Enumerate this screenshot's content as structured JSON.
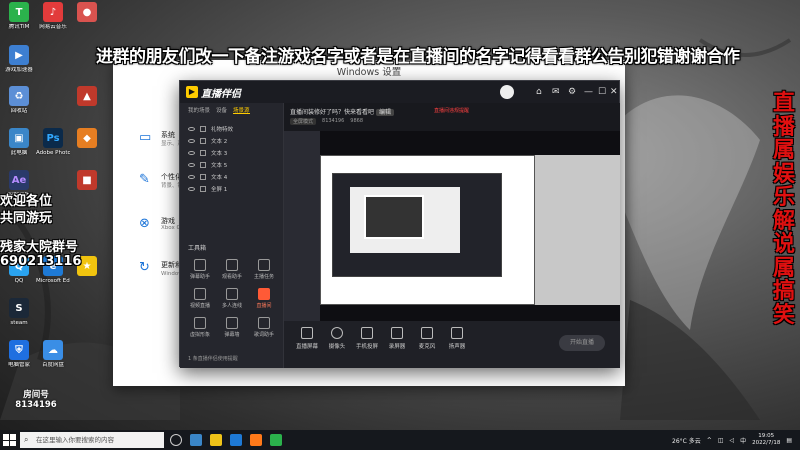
{
  "banner": {
    "top_text": "进群的朋友们改一下备注游戏名字或者是在直播间的名字记得看看群公告别犯错谢谢合作",
    "side_text": "直播属娱乐解说属搞笑",
    "welcome_line1": "欢迎各位",
    "welcome_line2": "共同游玩",
    "group_label": "残家大院群号",
    "group_number": "690213116",
    "room_label": "房间号",
    "room_number": "8134196"
  },
  "desktop": {
    "icons": [
      "腾讯TIM",
      "回收站",
      "游戏加速器",
      "此电脑",
      "Adobe Photoshop",
      "网易云音乐",
      "控制面板",
      "Microsoft Edge",
      "QQ",
      "steam",
      "百度网盘",
      "电脑管家"
    ]
  },
  "settings": {
    "title": "Windows 设置",
    "items": [
      {
        "title": "系统",
        "desc": "显示、声音"
      },
      {
        "title": "个性化",
        "desc": "背景、锁屏"
      },
      {
        "title": "游戏",
        "desc": "Xbox Game Bar"
      },
      {
        "title": "更新和安全",
        "desc": "Windows 更新"
      }
    ]
  },
  "app": {
    "name": "直播伴侣",
    "tabs": [
      "我的场景",
      "设备",
      "场景源"
    ],
    "scenes": [
      "礼物特效",
      "文本 2",
      "文本 3",
      "文本 5",
      "文本 4",
      "全屏 1"
    ],
    "toolbox_title": "工具箱",
    "tools": [
      {
        "label": "弹幕助手",
        "accent": false
      },
      {
        "label": "观看助手",
        "accent": false
      },
      {
        "label": "主播任务",
        "accent": false
      },
      {
        "label": "视频直播",
        "accent": false
      },
      {
        "label": "多人连线",
        "accent": false
      },
      {
        "label": "直播间",
        "accent": true
      },
      {
        "label": "虚拟形象",
        "accent": false
      },
      {
        "label": "弹幕墙",
        "accent": false
      },
      {
        "label": "歌词助手",
        "accent": false
      }
    ],
    "footer_text": "1 条直播伴侣使用提醒",
    "live_title": "直播间装修好了吗？快来看看吧",
    "edit_label": "编辑",
    "red_note": "直播间违规提醒",
    "meta": {
      "mode": "全屏模式",
      "fans": "8134196",
      "viewers": "9868"
    },
    "bottom_items": [
      "直播屏幕",
      "摄像头",
      "手机投屏",
      "录屏器",
      "麦克风",
      "扬声器"
    ],
    "start_label": "开始直播"
  },
  "taskbar": {
    "search_placeholder": "在这里输入你要搜索的内容",
    "weather": "26°C 多云",
    "ime": "中",
    "time": "19:05",
    "date": "2022/7/18"
  },
  "colors": {
    "accent": "#ffcc00",
    "live_red": "#ff5a36",
    "side_text_red": "#e01010"
  }
}
